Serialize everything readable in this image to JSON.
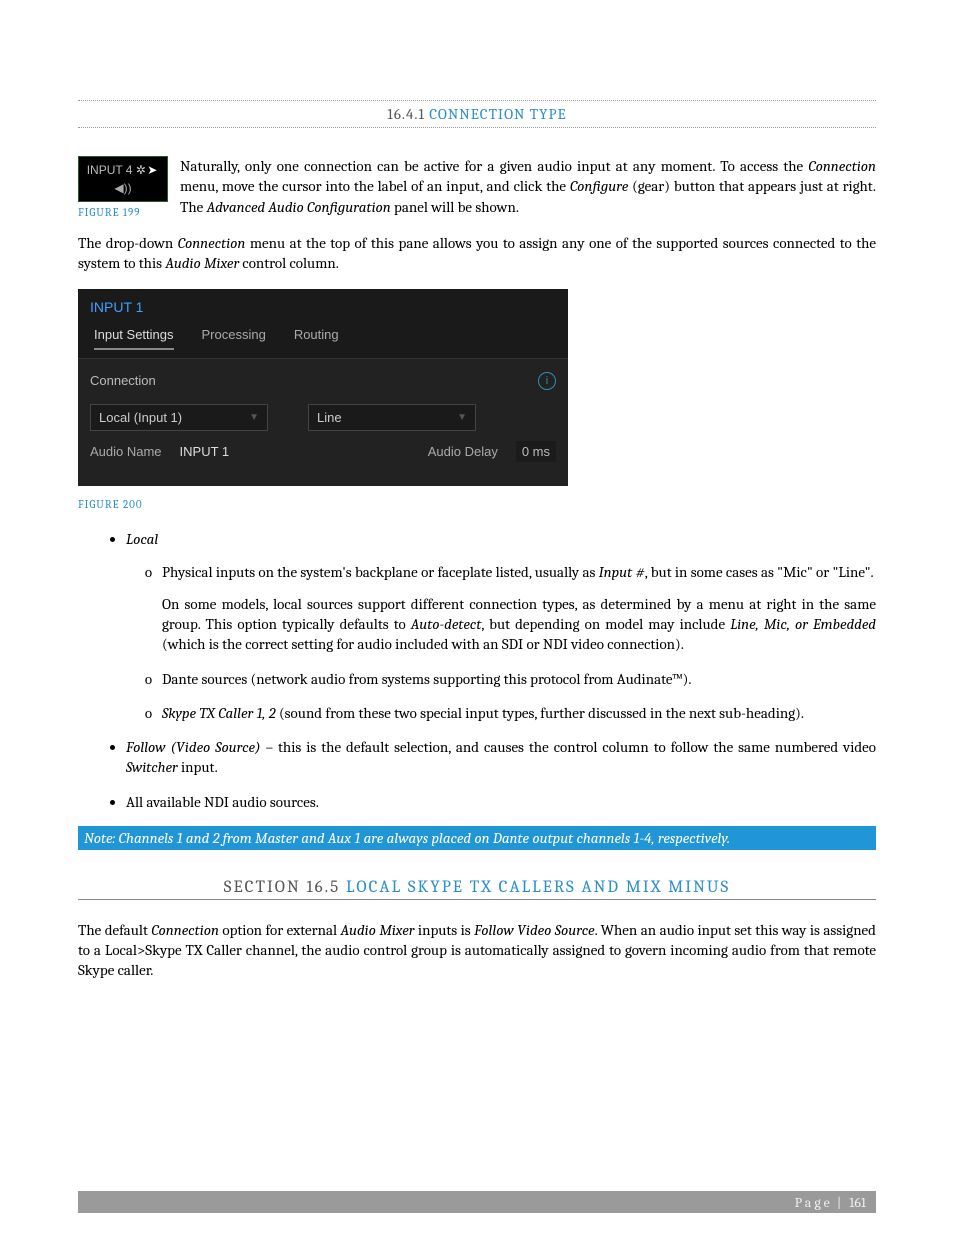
{
  "section1": {
    "number": "16.4.1",
    "title": "CONNECTION TYPE"
  },
  "fig199": {
    "label": "INPUT 4",
    "caption": "FIGURE 199"
  },
  "p1a": "Naturally, only one connection can be active for a given audio input at any moment. To access the ",
  "p1b": "Connection",
  "p1c": " menu, move the cursor into the label of an input, and click the ",
  "p1d": "Configure",
  "p1e": " (gear) button that appears just at right. The ",
  "p1f": "Advanced Audio Configuration",
  "p1g": " panel will be shown.",
  "p2a": "The drop-down ",
  "p2b": "Connection",
  "p2c": " menu at the top of this pane allows you to assign any one of the supported sources connected to the system to this ",
  "p2d": "Audio Mixer",
  "p2e": " control column.",
  "fig200": {
    "title": "INPUT 1",
    "tabs": [
      "Input Settings",
      "Processing",
      "Routing"
    ],
    "connection_label": "Connection",
    "source": "Local (Input 1)",
    "type": "Line",
    "audio_name_label": "Audio Name",
    "audio_name_value": "INPUT 1",
    "audio_delay_label": "Audio Delay",
    "audio_delay_value": "0 ms",
    "caption": "FIGURE 200"
  },
  "bullets": {
    "local": "Local",
    "local_sub1a": "Physical inputs on the system's backplane or faceplate listed, usually as ",
    "local_sub1b": "Input #",
    "local_sub1c": ", but in some cases as \"Mic\" or \"Line\".",
    "local_sub1_p2a": "On some models, local sources support different connection types, as determined by a menu at right in the same group.   This option typically defaults to ",
    "local_sub1_p2b": "Auto-detect",
    "local_sub1_p2c": ", but depending on model may include ",
    "local_sub1_p2d": "Line, Mic, or Embedded",
    "local_sub1_p2e": " (which is the correct setting for audio included with an SDI or NDI video connection).",
    "local_sub2": "Dante sources (network audio from systems supporting this protocol from Audinate™).",
    "local_sub3a": "Skype TX Caller 1, 2",
    "local_sub3b": "  (sound from these two special input types, further discussed in the next sub-heading).",
    "follow_a": "Follow (Video Source)",
    "follow_b": " – this is the default selection, and causes the control column to follow the same numbered video ",
    "follow_c": "Switcher",
    "follow_d": " input.",
    "ndi": "All available NDI audio sources."
  },
  "note": "Note: Channels 1 and 2 from Master and Aux 1 are always placed on Dante output channels 1-4, respectively.",
  "section2": {
    "number": "SECTION 16.5",
    "title": "LOCAL SKYPE TX CALLERS AND MIX MINUS"
  },
  "p3a": "The default ",
  "p3b": "Connection",
  "p3c": " option for external ",
  "p3d": "Audio Mixer",
  "p3e": " inputs is ",
  "p3f": "Follow Video Source",
  "p3g": ".  When an audio input set this way is assigned to a Local>Skype TX Caller channel, the audio control group is automatically assigned to govern incoming audio from that remote Skype caller.",
  "footer": {
    "label": "Page",
    "sep": "|",
    "num": "161"
  }
}
